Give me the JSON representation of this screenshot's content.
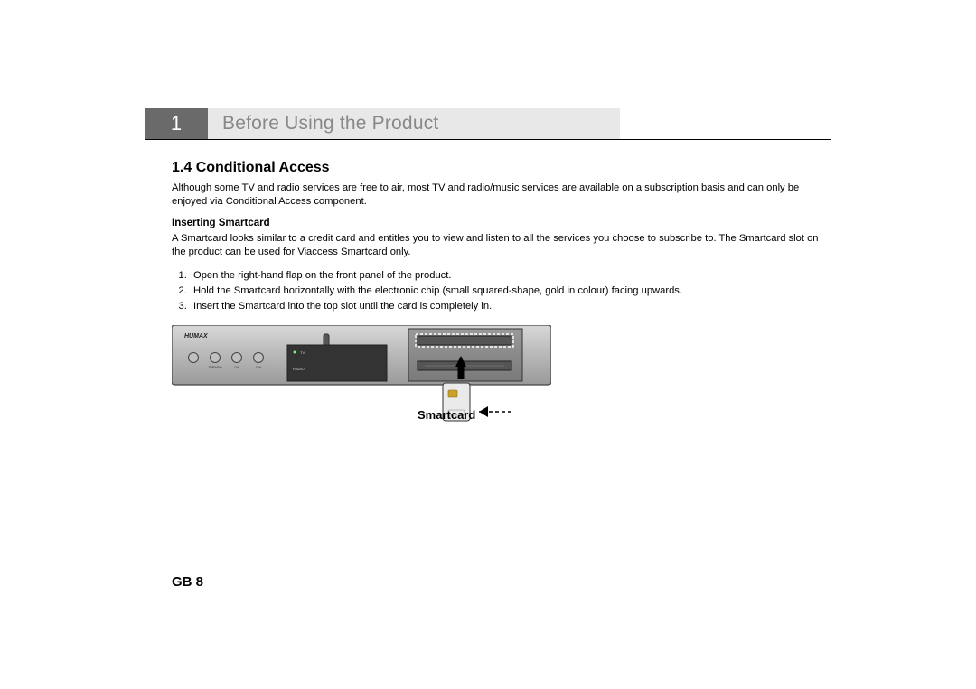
{
  "chapter": {
    "number": "1",
    "title": "Before Using the Product"
  },
  "section": {
    "number_title": "1.4 Conditional Access",
    "intro": "Although some TV and radio services are free to air, most TV and radio/music services are available on a subscription basis and can only be enjoyed via Conditional Access component.",
    "sub_heading": "Inserting Smartcard",
    "sub_intro": "A Smartcard looks similar to a credit card and entitles you to view and listen to all the services you choose to subscribe to. The Smartcard slot on the product can be used for Viaccess Smartcard only.",
    "steps": [
      "Open the right-hand flap on the front panel of the product.",
      "Hold the Smartcard horizontally with the electronic chip (small squared-shape, gold in colour) facing upwards.",
      "Insert the Smartcard into the top slot until the card is completely in."
    ]
  },
  "illustration": {
    "brand": "HUMAX",
    "buttons": [
      "",
      "TV/RADIO",
      "CH-",
      "CH+"
    ],
    "tv_label": "TV",
    "radio_label": "RADIO",
    "smartcard_label": "Smartcard"
  },
  "footer": {
    "page": "GB 8"
  }
}
